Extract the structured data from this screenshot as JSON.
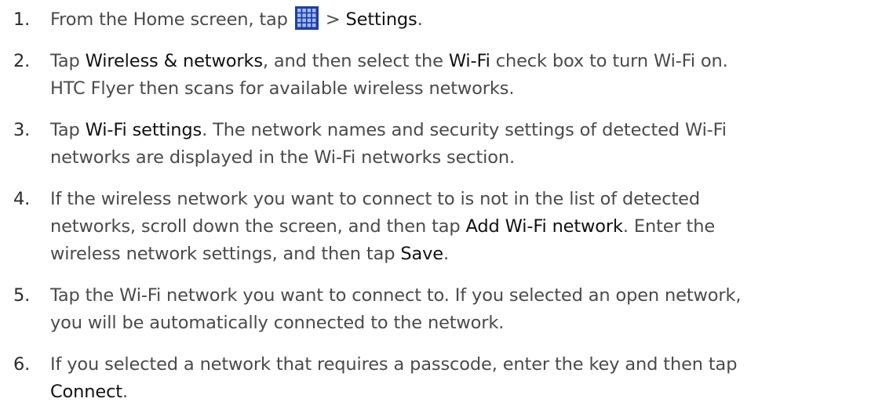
{
  "steps": [
    {
      "number": "1.",
      "lines": [
        [
          {
            "text": "From the Home screen, tap "
          },
          {
            "icon": "all-apps-grid-icon"
          },
          {
            "text": " > "
          },
          {
            "text": "Settings",
            "highlight": true
          },
          {
            "text": "."
          }
        ]
      ]
    },
    {
      "number": "2.",
      "lines": [
        [
          {
            "text": "Tap "
          },
          {
            "text": "Wireless & networks",
            "highlight": true
          },
          {
            "text": ", and then select the "
          },
          {
            "text": "Wi-Fi",
            "highlight": true
          },
          {
            "text": " check box to turn Wi-Fi on."
          }
        ],
        [
          {
            "text": "HTC Flyer then scans for available wireless networks."
          }
        ]
      ]
    },
    {
      "number": "3.",
      "lines": [
        [
          {
            "text": "Tap "
          },
          {
            "text": "Wi-Fi settings",
            "highlight": true
          },
          {
            "text": ". The network names and security settings of detected Wi-Fi"
          }
        ],
        [
          {
            "text": "networks are displayed in the Wi-Fi networks section."
          }
        ]
      ]
    },
    {
      "number": "4.",
      "lines": [
        [
          {
            "text": "If the wireless network you want to connect to is not in the list of detected"
          }
        ],
        [
          {
            "text": "networks, scroll down the screen, and then tap "
          },
          {
            "text": "Add Wi-Fi network",
            "highlight": true
          },
          {
            "text": ". Enter the"
          }
        ],
        [
          {
            "text": "wireless network settings, and then tap "
          },
          {
            "text": "Save",
            "highlight": true
          },
          {
            "text": "."
          }
        ]
      ]
    },
    {
      "number": "5.",
      "lines": [
        [
          {
            "text": "Tap the Wi-Fi network you want to connect to. If you selected an open network,"
          }
        ],
        [
          {
            "text": "you will be automatically connected to the network."
          }
        ]
      ]
    },
    {
      "number": "6.",
      "lines": [
        [
          {
            "text": "If you selected a network that requires a passcode, enter the key and then tap"
          }
        ],
        [
          {
            "text": "Connect",
            "highlight": true
          },
          {
            "text": "."
          }
        ]
      ]
    }
  ],
  "colors": {
    "body_text": "#4a4a4a",
    "highlight_text": "#111111",
    "icon_background": "#1f3f9e",
    "icon_cells": "#9fb8ff"
  }
}
